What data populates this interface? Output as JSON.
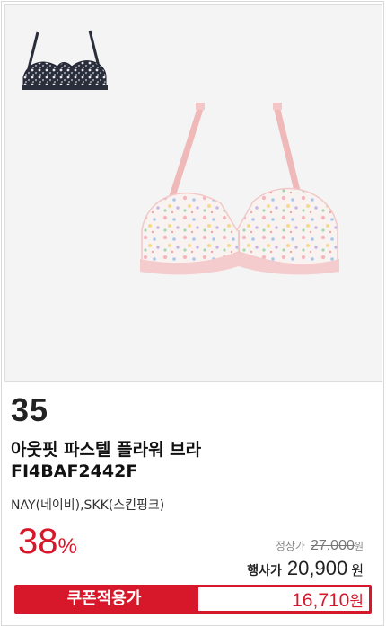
{
  "product": {
    "rank": "35",
    "name": "아웃핏 파스텔 플라워 브라",
    "code": "FI4BAF2442F",
    "colors": "NAY(네이비),SKK(스킨핑크)",
    "discount": {
      "value": "38",
      "unit": "%"
    },
    "regular_price": {
      "label": "정상가",
      "value": "27,000",
      "unit": "원"
    },
    "event_price": {
      "label": "행사가",
      "value": "20,900",
      "unit": "원"
    },
    "coupon_price": {
      "label": "쿠폰적용가",
      "value": "16,710",
      "unit": "원"
    }
  },
  "colors": {
    "accent": "#d6182a",
    "image_bg": "#f4f4f4",
    "bra_pink": "#f2c4c4",
    "thumb_navy": "#2a2d3a"
  }
}
